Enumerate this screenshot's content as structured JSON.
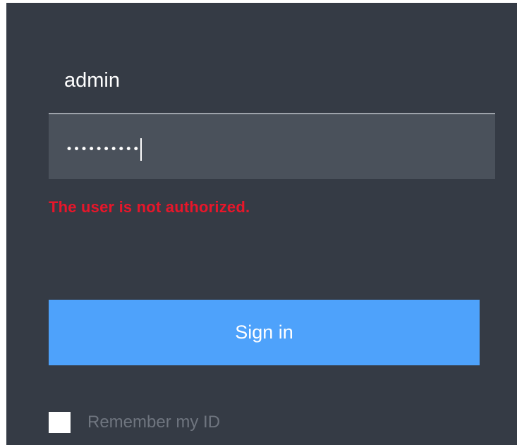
{
  "login": {
    "username_value": "admin",
    "password_masked": "••••••••••",
    "error_message": "The user is not authorized.",
    "signin_label": "Sign in",
    "remember_label": "Remember my ID",
    "remember_checked": false
  },
  "colors": {
    "panel_bg": "#353b45",
    "input_bg": "#4a515b",
    "error": "#e8162a",
    "button": "#4ea2fb",
    "muted_text": "#6f757f"
  }
}
